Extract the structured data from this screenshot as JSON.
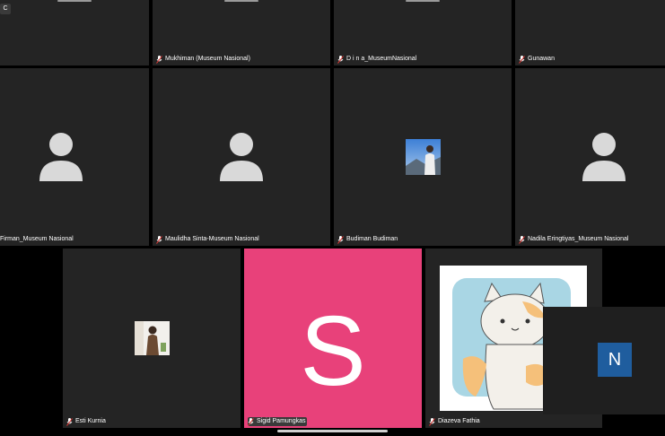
{
  "top_left_badge": "C",
  "participants": [
    {
      "name": "Mukhiman (Museum Nasional)"
    },
    {
      "name": "D i n a_MuseumNasional"
    },
    {
      "name": "Gunawan"
    },
    {
      "name": "Firman_Museum Nasional"
    },
    {
      "name": "Maulidha Sinta-Museum Nasional"
    },
    {
      "name": "Budiman Budiman"
    },
    {
      "name": "Nadila Eringtiyas_Museum Nasional"
    },
    {
      "name": "Esti Kurnia"
    },
    {
      "name": "Sigid Pamungkas",
      "initial": "S"
    },
    {
      "name": "Diazeva Fathia"
    }
  ],
  "self_view": {
    "initial": "N"
  },
  "colors": {
    "tile_bg": "#242424",
    "pink_avatar": "#e8417a",
    "self_avatar": "#1f5d9e"
  }
}
